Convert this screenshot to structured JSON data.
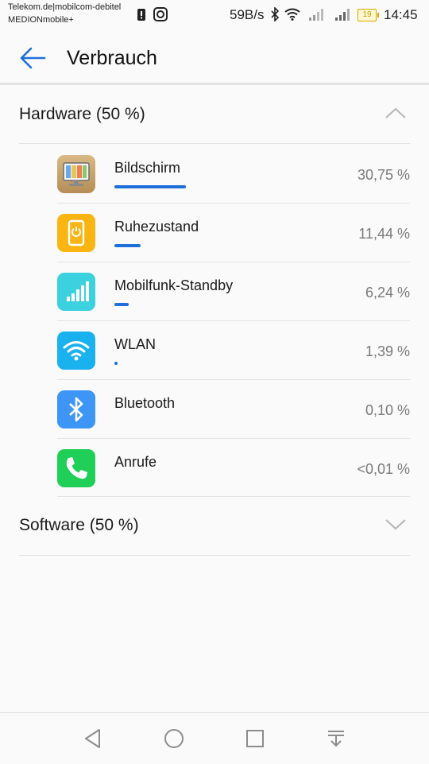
{
  "status_bar": {
    "carrier_line1": "Telekom.de|mobilcom-debitel",
    "carrier_line2": "MEDIONmobile+",
    "net_speed": "59B/s",
    "battery": "19",
    "time": "14:45",
    "icons": [
      "alert-icon",
      "app-notification-icon",
      "bluetooth-icon",
      "wifi-icon",
      "signal-icon",
      "signal-icon",
      "battery-icon"
    ]
  },
  "header": {
    "title": "Verbrauch"
  },
  "hardware": {
    "label": "Hardware (50 %)",
    "expanded": true,
    "items": [
      {
        "name": "Bildschirm",
        "percent": "30,75 %",
        "share": 0.3075,
        "icon": "display-icon",
        "color": "#c8a46a"
      },
      {
        "name": "Ruhezustand",
        "percent": "11,44 %",
        "share": 0.1144,
        "icon": "standby-icon",
        "color": "#fbb512"
      },
      {
        "name": "Mobilfunk-Standby",
        "percent": "6,24 %",
        "share": 0.0624,
        "icon": "cell-signal-icon",
        "color": "#3bd1df"
      },
      {
        "name": "WLAN",
        "percent": "1,39 %",
        "share": 0.0139,
        "icon": "wifi-icon",
        "color": "#1ab2ee"
      },
      {
        "name": "Bluetooth",
        "percent": "0,10 %",
        "share": 0.001,
        "icon": "bluetooth-icon",
        "color": "#3d95f5"
      },
      {
        "name": "Anrufe",
        "percent": "<0,01 %",
        "share": 0.0,
        "icon": "phone-icon",
        "color": "#20cf58"
      }
    ]
  },
  "software": {
    "label": "Software (50 %)",
    "expanded": false
  },
  "colors": {
    "accent": "#1e6fd9",
    "background": "#fafafa"
  },
  "nav": [
    "back-nav-icon",
    "home-nav-icon",
    "recents-nav-icon",
    "notifications-nav-icon"
  ]
}
